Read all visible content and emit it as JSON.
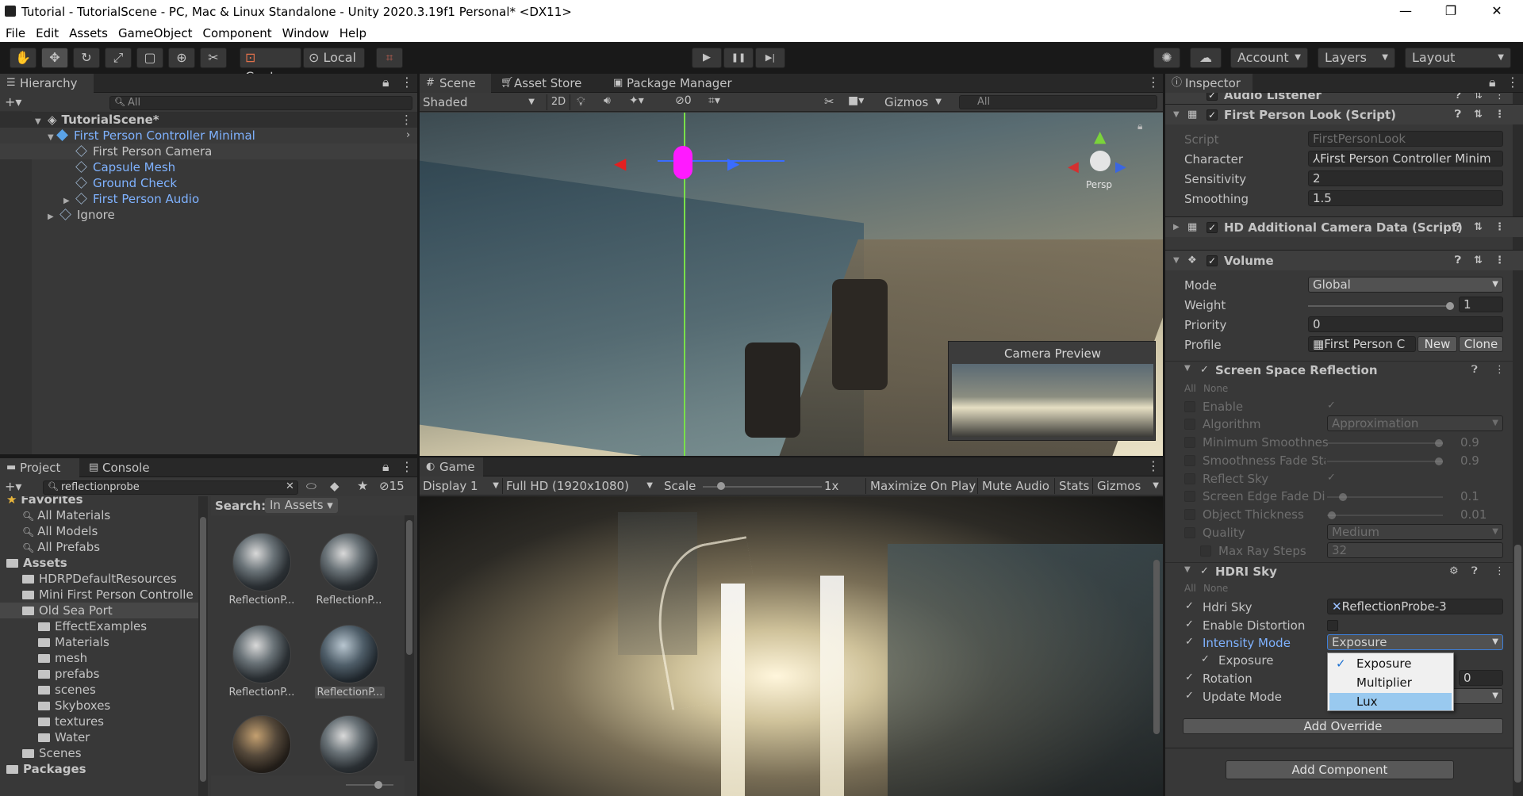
{
  "window": {
    "title": "Tutorial - TutorialScene - PC, Mac & Linux Standalone - Unity 2020.3.19f1 Personal* <DX11>",
    "min": "—",
    "max": "❐",
    "close": "✕"
  },
  "menu": [
    "File",
    "Edit",
    "Assets",
    "GameObject",
    "Component",
    "Window",
    "Help"
  ],
  "toolbar": {
    "pivot": "Center",
    "space": "Local",
    "account": "Account",
    "layers": "Layers",
    "layout": "Layout",
    "play": "▶",
    "pause": "❚❚",
    "step": "▶|"
  },
  "hierarchy": {
    "tab": "Hierarchy",
    "search": "All",
    "scene": "TutorialScene*",
    "items": [
      "First Person Controller Minimal",
      "First Person Camera",
      "Capsule Mesh",
      "Ground Check",
      "First Person Audio",
      "Ignore"
    ]
  },
  "scene": {
    "tabs": [
      "Scene",
      "Asset Store",
      "Package Manager"
    ],
    "shading": "Shaded",
    "mode2d": "2D",
    "hidden_count": "0",
    "gizmos": "Gizmos",
    "search": "All",
    "gizmo_label": "Persp",
    "camera_preview": "Camera Preview"
  },
  "game": {
    "tab": "Game",
    "display": "Display 1",
    "resolution": "Full HD (1920x1080)",
    "scale_label": "Scale",
    "scale_value": "1x",
    "scale_fraction": 0.15,
    "buttons": [
      "Maximize On Play",
      "Mute Audio",
      "Stats",
      "Gizmos"
    ]
  },
  "project": {
    "tabs": [
      "Project",
      "Console"
    ],
    "search": "reflectionprobe",
    "hidden_count": "15",
    "search_in_label": "Search:",
    "search_in": "In Assets",
    "tree": [
      {
        "label": "Favorites",
        "kind": "fav",
        "indent": 0
      },
      {
        "label": "All Materials",
        "kind": "search",
        "indent": 1
      },
      {
        "label": "All Models",
        "kind": "search",
        "indent": 1
      },
      {
        "label": "All Prefabs",
        "kind": "search",
        "indent": 1
      },
      {
        "label": "Assets",
        "kind": "root",
        "indent": 0
      },
      {
        "label": "HDRPDefaultResources",
        "kind": "folder",
        "indent": 1
      },
      {
        "label": "Mini First Person Controlle",
        "kind": "folder",
        "indent": 1
      },
      {
        "label": "Old Sea Port",
        "kind": "folder",
        "indent": 1
      },
      {
        "label": "EffectExamples",
        "kind": "folder",
        "indent": 2
      },
      {
        "label": "Materials",
        "kind": "folder",
        "indent": 2
      },
      {
        "label": "mesh",
        "kind": "folder",
        "indent": 2
      },
      {
        "label": "prefabs",
        "kind": "folder",
        "indent": 2
      },
      {
        "label": "scenes",
        "kind": "folder",
        "indent": 2
      },
      {
        "label": "Skyboxes",
        "kind": "folder",
        "indent": 2
      },
      {
        "label": "textures",
        "kind": "folder",
        "indent": 2
      },
      {
        "label": "Water",
        "kind": "folder",
        "indent": 2
      },
      {
        "label": "Scenes",
        "kind": "folder",
        "indent": 1
      },
      {
        "label": "Packages",
        "kind": "root",
        "indent": 0
      }
    ],
    "assets": [
      "ReflectionP...",
      "ReflectionP...",
      "ReflectionP...",
      "ReflectionP...",
      "",
      ""
    ]
  },
  "inspector": {
    "tab": "Inspector",
    "audio_listener": "Audio Listener",
    "fpl": {
      "title": "First Person Look (Script)",
      "script_label": "Script",
      "script": "FirstPersonLook",
      "character_label": "Character",
      "character": "First Person Controller Minim",
      "sensitivity_label": "Sensitivity",
      "sensitivity": "2",
      "smoothing_label": "Smoothing",
      "smoothing": "1.5"
    },
    "hdcam": "HD Additional Camera Data (Script)",
    "volume": {
      "title": "Volume",
      "mode_label": "Mode",
      "mode": "Global",
      "weight_label": "Weight",
      "weight": "1",
      "priority_label": "Priority",
      "priority": "0",
      "profile_label": "Profile",
      "profile": "First Person C",
      "new": "New",
      "clone": "Clone"
    },
    "ssr": {
      "title": "Screen Space Reflection",
      "all": "All",
      "none": "None",
      "enable": "Enable",
      "algorithm_label": "Algorithm",
      "algorithm": "Approximation",
      "min_smooth_label": "Minimum Smoothnes",
      "min_smooth": "0.9",
      "smooth_fade_label": "Smoothness Fade Sta",
      "smooth_fade": "0.9",
      "reflect_sky": "Reflect Sky",
      "edge_fade_label": "Screen Edge Fade Di",
      "edge_fade": "0.1",
      "thickness_label": "Object Thickness",
      "thickness": "0.01",
      "quality_label": "Quality",
      "quality": "Medium",
      "max_steps_label": "Max Ray Steps",
      "max_steps": "32"
    },
    "hdri": {
      "title": "HDRI Sky",
      "all": "All",
      "none": "None",
      "sky_label": "Hdri Sky",
      "sky": "ReflectionProbe-3",
      "distortion_label": "Enable Distortion",
      "intensity_label": "Intensity Mode",
      "intensity": "Exposure",
      "exposure_label": "Exposure",
      "rotation_label": "Rotation",
      "rotation": "0",
      "update_label": "Update Mode",
      "dropdown": [
        "Exposure",
        "Multiplier",
        "Lux"
      ]
    },
    "add_override": "Add Override",
    "add_component": "Add Component"
  }
}
